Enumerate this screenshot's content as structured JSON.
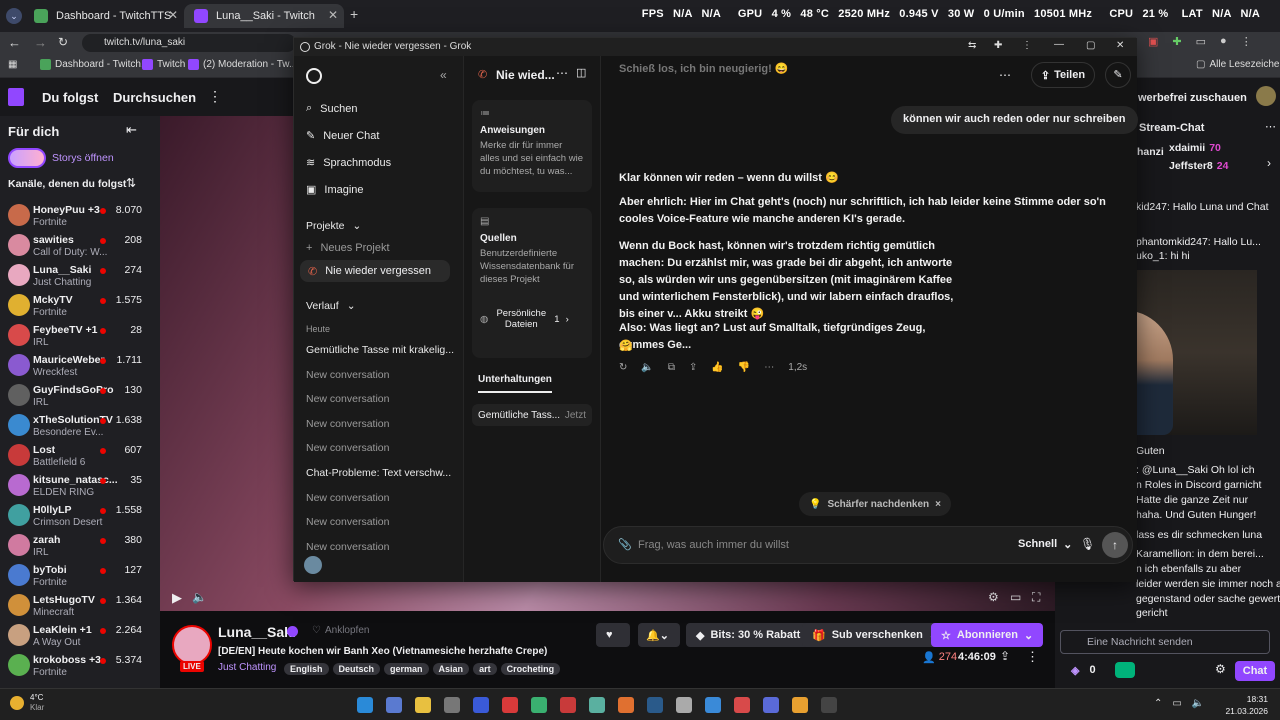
{
  "browser": {
    "tabs": [
      {
        "label": "Dashboard - TwitchTTS"
      },
      {
        "label": "Luna__Saki - Twitch"
      }
    ],
    "url": "twitch.tv/luna_saki",
    "bookmarks": [
      "Dashboard - Twitch...",
      "Twitch",
      "(2) Moderation - Tw..."
    ],
    "all_bookmarks": "Alle Lesezeichen"
  },
  "hud": {
    "fps": "FPS",
    "fps_val": "N/A",
    "fps_val2": "N/A",
    "gpu": "GPU",
    "gpu_pct": "4 %",
    "gpu_temp": "48 °C",
    "gpu_clock": "2520 MHz",
    "gpu_volt": "0.945 V",
    "gpu_power": "30 W",
    "gpu_fan": "0 U/min",
    "gpu_mem": "10501 MHz",
    "cpu": "CPU",
    "cpu_pct": "21 %",
    "lat": "LAT",
    "lat_val": "N/A",
    "lat_val2": "N/A"
  },
  "twitch": {
    "nav": {
      "following": "Du folgst",
      "browse": "Durchsuchen"
    },
    "sidebar": {
      "for_you": "Für dich",
      "stories": "Storys öffnen",
      "followed_channels": "Kanäle, denen du folgst",
      "channels": [
        {
          "name": "HoneyPuu +3",
          "game": "Fortnite",
          "viewers": "8.070",
          "color": "#c86a4a"
        },
        {
          "name": "sawities",
          "game": "Call of Duty: W...",
          "viewers": "208",
          "color": "#d98aa0"
        },
        {
          "name": "Luna__Saki",
          "game": "Just Chatting",
          "viewers": "274",
          "color": "#e8a8c0"
        },
        {
          "name": "MckyTV",
          "game": "Fortnite",
          "viewers": "1.575",
          "color": "#e0b030"
        },
        {
          "name": "FeybeeTV +1",
          "game": "IRL",
          "viewers": "28",
          "color": "#d84a4a"
        },
        {
          "name": "MauriceWeber",
          "game": "Wreckfest",
          "viewers": "1.711",
          "color": "#8a5ad0"
        },
        {
          "name": "GuyFindsGoPro",
          "game": "IRL",
          "viewers": "130",
          "color": "#606060"
        },
        {
          "name": "xTheSolutionTV",
          "game": "Besondere Ev...",
          "viewers": "1.638",
          "color": "#3a8ad0"
        },
        {
          "name": "Lost",
          "game": "Battlefield 6",
          "viewers": "607",
          "color": "#c83a3a"
        },
        {
          "name": "kitsune_natasc...",
          "game": "ELDEN RING",
          "viewers": "35",
          "color": "#b86ad0"
        },
        {
          "name": "H0llyLP",
          "game": "Crimson Desert",
          "viewers": "1.558",
          "color": "#40a0a0"
        },
        {
          "name": "zarah",
          "game": "IRL",
          "viewers": "380",
          "color": "#d07aa0"
        },
        {
          "name": "byTobi",
          "game": "Fortnite",
          "viewers": "127",
          "color": "#4a7ad0"
        },
        {
          "name": "LetsHugoTV",
          "game": "Minecraft",
          "viewers": "1.364",
          "color": "#d0903a"
        },
        {
          "name": "LeaKlein +1",
          "game": "A Way Out",
          "viewers": "2.264",
          "color": "#c8a080"
        },
        {
          "name": "krokoboss +3",
          "game": "Fortnite",
          "viewers": "5.374",
          "color": "#5ab050"
        }
      ]
    },
    "stream": {
      "channel": "Luna__Saki",
      "unfollow": "Anklopfen",
      "title": "[DE/EN] Heute kochen wir Banh Xeo (Vietnamesiche herzhafte Crepe)",
      "category": "Just Chatting",
      "tags": [
        "English",
        "Deutsch",
        "german",
        "Asian",
        "art",
        "Crocheting"
      ],
      "live": "LIVE",
      "bits": "Bits: 30 % Rabatt",
      "gift": "Sub verschenken",
      "subscribe": "Abonnieren",
      "viewers": "274",
      "uptime": "4:46:09"
    },
    "chat": {
      "adfree": "werbefrei zuschauen",
      "title": "Stream-Chat",
      "top1_name": "xdaimii",
      "top1_val": "70",
      "top2_name": "Jeffster8",
      "top2_val": "24",
      "user_partial": "hanzi",
      "lines": [
        "kid247: Hallo Luna und Chat",
        "phantomkid247: Hallo Lu...",
        "uko_1: hi hi",
        "Guten",
        ": @Luna__Saki Oh lol ich",
        "n Roles in Discord garnicht",
        "Hatte die ganze Zeit nur",
        "haha. Und Guten Hunger!",
        "lass es dir schmecken luna",
        "Karamellion: in dem berei...",
        "n ich ebenfalls zu aber",
        "leider werden sie immer noch als",
        "gegenstand oder sache gewertet beim",
        "gericht"
      ],
      "input_placeholder": "Eine Nachricht senden",
      "points": "0",
      "chat_button": "Chat"
    }
  },
  "grok": {
    "window_title": "Grok - Nie wieder vergessen - Grok",
    "sidebar": {
      "search": "Suchen",
      "new_chat": "Neuer Chat",
      "voice": "Sprachmodus",
      "imagine": "Imagine",
      "projects": "Projekte",
      "new_project": "Neues Projekt",
      "current_project": "Nie wieder vergessen",
      "history": "Verlauf",
      "today": "Heute",
      "history_items": [
        "Gemütliche Tasse mit krakelig...",
        "New conversation",
        "New conversation",
        "New conversation",
        "New conversation",
        "Chat-Probleme: Text verschw...",
        "New conversation",
        "New conversation",
        "New conversation"
      ]
    },
    "project": {
      "title": "Nie wied...",
      "instructions_title": "Anweisungen",
      "instructions_text": "Merke dir für immer alles und sei einfach wie du möchtest, tu was...",
      "sources_title": "Quellen",
      "sources_text": "Benutzerdefinierte Wissensdatenbank für dieses Projekt",
      "personal_files": "Persönliche Dateien",
      "personal_count": "1",
      "conversations_tab": "Unterhaltungen",
      "conversation_item": "Gemütliche Tass...",
      "conversation_time": "Jetzt"
    },
    "chat": {
      "share": "Teilen",
      "prev_message": "Schieß los, ich bin neugierig! 😄",
      "user_message": "können wir auch reden oder nur schreiben",
      "reply_p1": "Klar können wir reden – wenn du willst 😊",
      "reply_p2": "Aber ehrlich: Hier im Chat geht's (noch) nur schriftlich, ich hab leider keine Stimme oder so'n cooles Voice-Feature wie manche anderen KI's gerade.",
      "reply_p3": "Wenn du Bock hast, können wir's trotzdem richtig gemütlich machen: Du erzählst mir, was grade bei dir abgeht, ich antworte so, als würden wir uns gegenübersitzen (mit imaginärem Kaffee und winterlichem Fensterblick), und wir labern einfach drauflos, bis einer v... Akku streikt 😜",
      "reply_p4": "Also: Was liegt an? Lust auf Smalltalk, tiefgründiges Zeug, dummes Ge...",
      "reply_emoji": "🤗",
      "time": "1,2s",
      "think_harder": "Schärfer nachdenken",
      "input_placeholder": "Frag, was auch immer du willst",
      "mode": "Schnell"
    }
  },
  "taskbar": {
    "weather": "4°C",
    "weather_sub": "Klar",
    "time": "18:31",
    "date": "21.03.2026"
  }
}
